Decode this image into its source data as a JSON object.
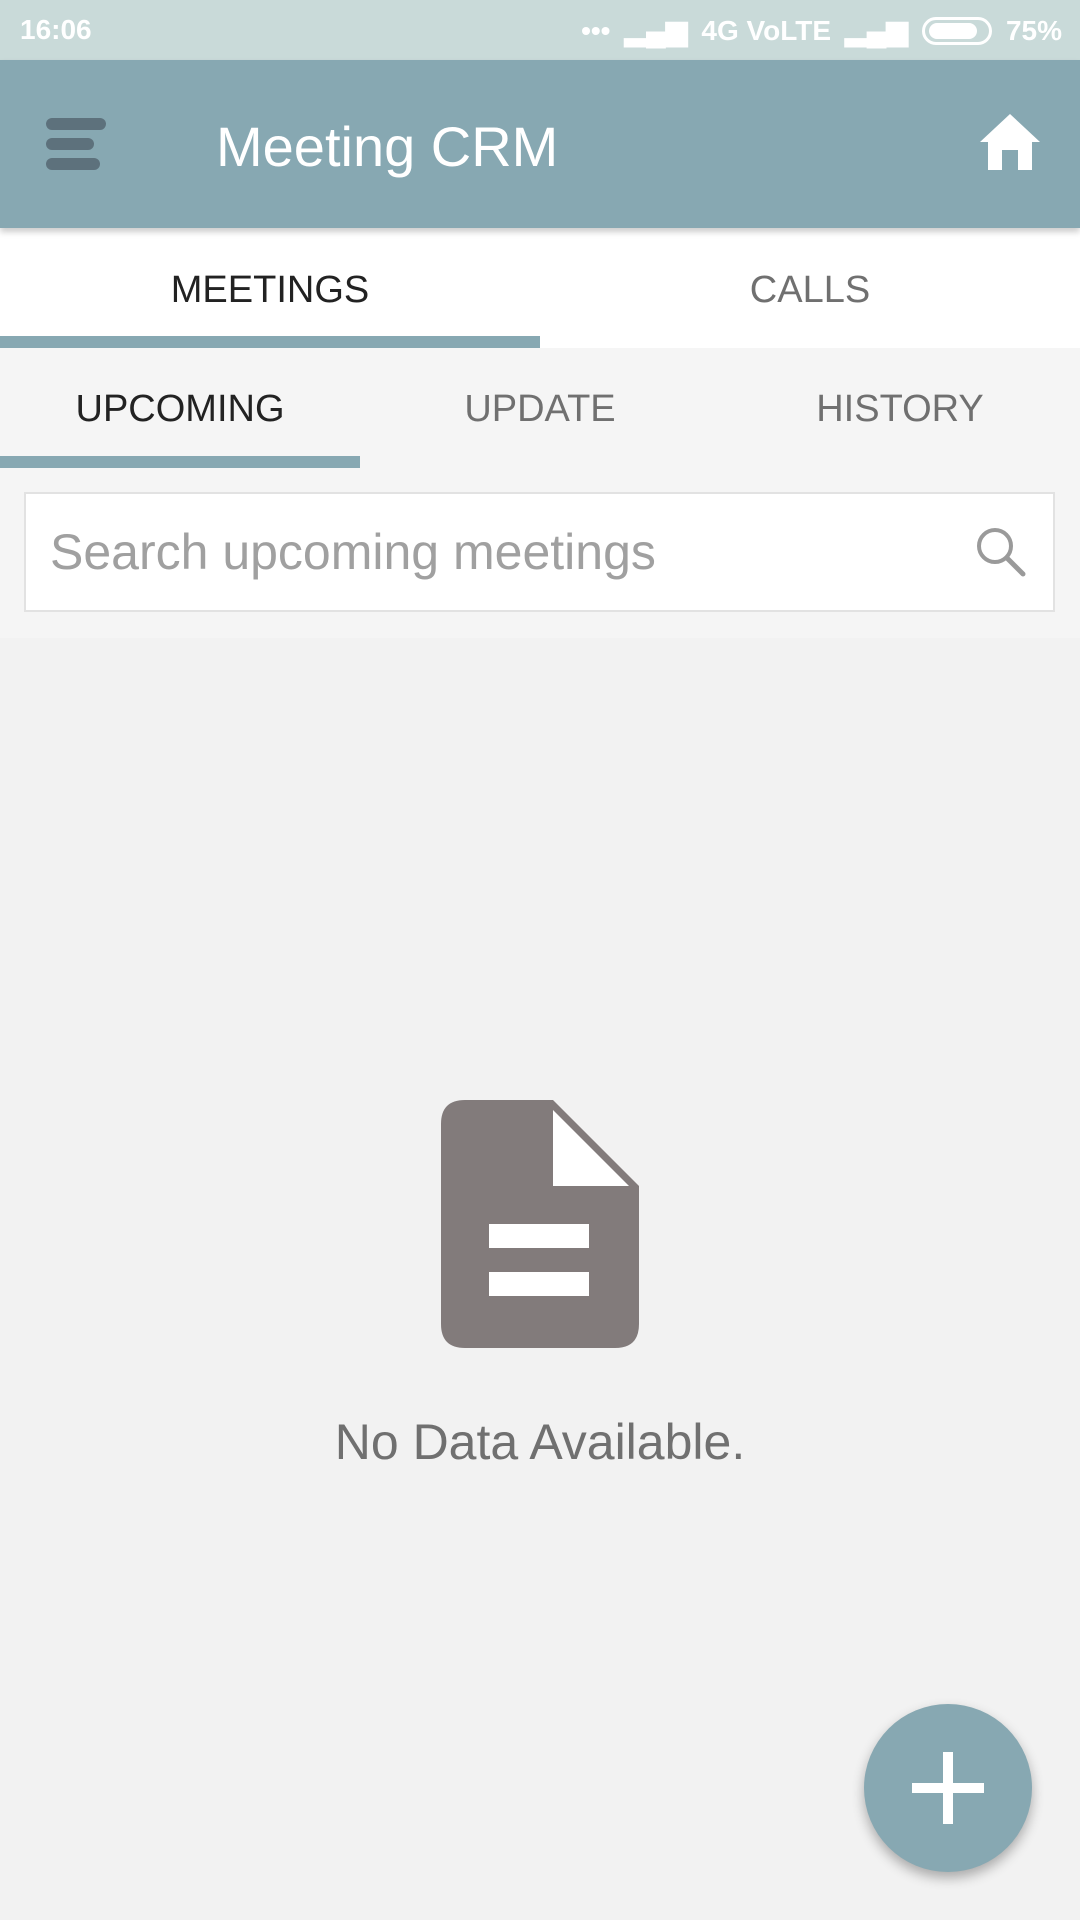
{
  "status_bar": {
    "time": "16:06",
    "network": "4G VoLTE",
    "battery": "75%",
    "battery_level": 0.75
  },
  "app_bar": {
    "title": "Meeting CRM",
    "menu_icon": "hamburger-icon",
    "home_icon": "home-icon"
  },
  "tabs": [
    {
      "label": "MEETINGS",
      "active": true
    },
    {
      "label": "CALLS",
      "active": false
    }
  ],
  "sub_tabs": [
    {
      "label": "UPCOMING",
      "active": true
    },
    {
      "label": "UPDATE",
      "active": false
    },
    {
      "label": "HISTORY",
      "active": false
    }
  ],
  "search": {
    "placeholder": "Search upcoming meetings",
    "value": ""
  },
  "empty_state": {
    "icon": "document-icon",
    "message": "No Data Available."
  },
  "fab": {
    "icon": "plus-icon"
  },
  "colors": {
    "accent": "#87a8b2",
    "status_bar": "#c9dad9",
    "icon_gray": "#827b7b"
  }
}
